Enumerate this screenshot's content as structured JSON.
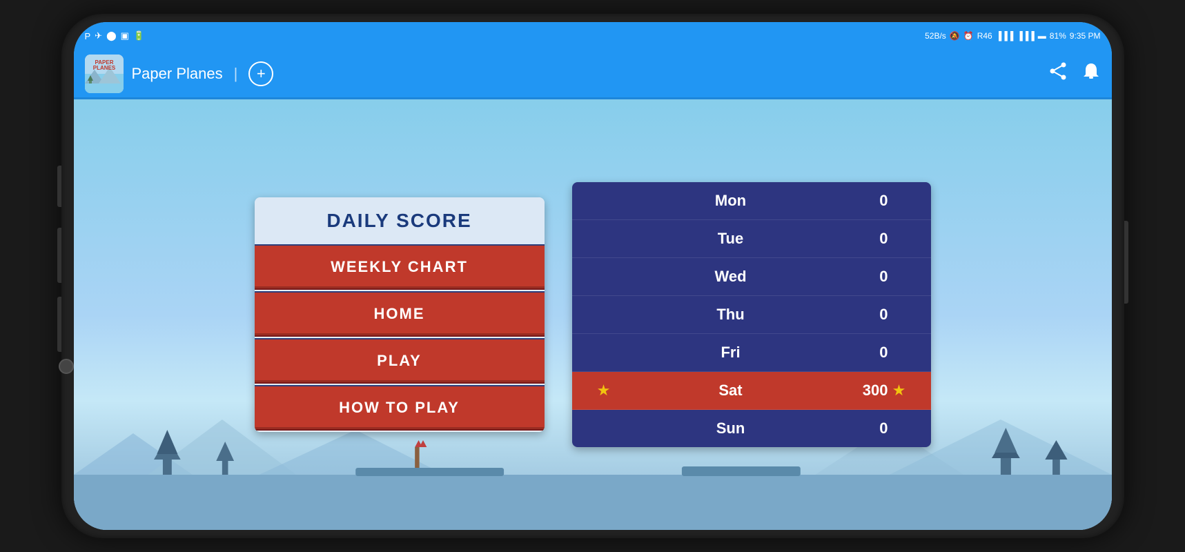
{
  "statusBar": {
    "left": {
      "icons": [
        "P",
        "◀",
        "⬤",
        "▣",
        "🔋"
      ]
    },
    "right": {
      "speed": "52B/s",
      "wifi": "🔕",
      "alarm": "⏰",
      "network": "R46",
      "signal1": "▐▐▐",
      "signal2": "▐▐▐",
      "battery": "81%",
      "time": "9:35 PM"
    }
  },
  "appBar": {
    "title": "Paper Planes",
    "addBtn": "+",
    "shareIcon": "share",
    "notifIcon": "bell"
  },
  "dailyScore": {
    "title": "DAILY SCORE",
    "buttons": [
      {
        "label": "WEEKLY CHART",
        "key": "weekly"
      },
      {
        "label": "HOME",
        "key": "home"
      },
      {
        "label": "PLAY",
        "key": "play"
      },
      {
        "label": "HOW TO PLAY",
        "key": "how"
      }
    ]
  },
  "weeklyChart": {
    "rows": [
      {
        "day": "Mon",
        "score": "0",
        "highlight": false,
        "starLeft": false,
        "starRight": false
      },
      {
        "day": "Tue",
        "score": "0",
        "highlight": false,
        "starLeft": false,
        "starRight": false
      },
      {
        "day": "Wed",
        "score": "0",
        "highlight": false,
        "starLeft": false,
        "starRight": false
      },
      {
        "day": "Thu",
        "score": "0",
        "highlight": false,
        "starLeft": false,
        "starRight": false
      },
      {
        "day": "Fri",
        "score": "0",
        "highlight": false,
        "starLeft": false,
        "starRight": false
      },
      {
        "day": "Sat",
        "score": "300",
        "highlight": true,
        "starLeft": true,
        "starRight": true
      },
      {
        "day": "Sun",
        "score": "0",
        "highlight": false,
        "starLeft": false,
        "starRight": false
      }
    ]
  }
}
